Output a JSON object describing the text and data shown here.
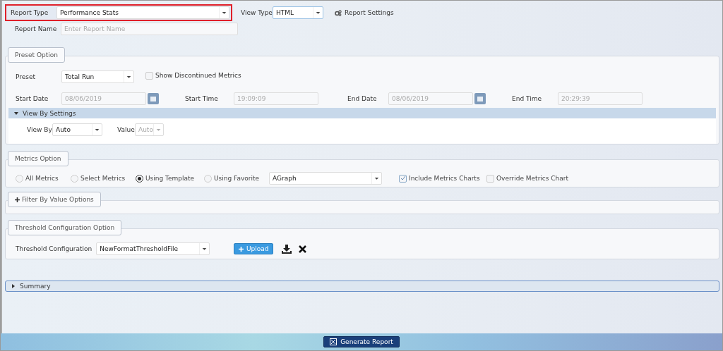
{
  "report_type": {
    "label": "Report Type",
    "value": "Performance Stats",
    "highlighted": true
  },
  "view_type": {
    "label": "View Type",
    "value": "HTML"
  },
  "report_settings": "Report Settings",
  "report_name": {
    "label": "Report Name",
    "placeholder": "Enter Report Name"
  },
  "preset_section": {
    "title": "Preset Option",
    "preset": {
      "label": "Preset",
      "value": "Total Run"
    },
    "show_discontinued": {
      "label": "Show Discontinued Metrics",
      "checked": false
    },
    "fields": [
      {
        "label": "Start Date",
        "value": "08/06/2019",
        "kind": "date"
      },
      {
        "label": "Start Time",
        "value": "19:09:09",
        "kind": "time"
      },
      {
        "label": "End Date",
        "value": "08/06/2019",
        "kind": "date"
      },
      {
        "label": "End Time",
        "value": "20:29:39",
        "kind": "time"
      }
    ],
    "view_by_settings": {
      "title": "View By Settings",
      "expanded": true,
      "view_by": {
        "label": "View By",
        "value": "Auto"
      },
      "value": {
        "label": "Value",
        "value": "Auto",
        "disabled": true
      }
    }
  },
  "metrics_section": {
    "title": "Metrics Option",
    "options": [
      {
        "label": "All Metrics",
        "selected": false
      },
      {
        "label": "Select Metrics",
        "selected": false
      },
      {
        "label": "Using Template",
        "selected": true
      },
      {
        "label": "Using Favorite",
        "selected": false
      }
    ],
    "template": "AGraph",
    "checkboxes": [
      {
        "label": "Include Metrics Charts",
        "checked": true
      },
      {
        "label": "Override Metrics Chart",
        "checked": false
      }
    ]
  },
  "filter_section": {
    "title": "Filter By Value Options",
    "expanded": false
  },
  "threshold_section": {
    "title": "Threshold Configuration Option",
    "label": "Threshold Configuration",
    "value": "NewFormatThresholdFile",
    "upload": "Upload"
  },
  "summary": {
    "title": "Summary",
    "expanded": false
  },
  "generate_button": "Generate Report"
}
